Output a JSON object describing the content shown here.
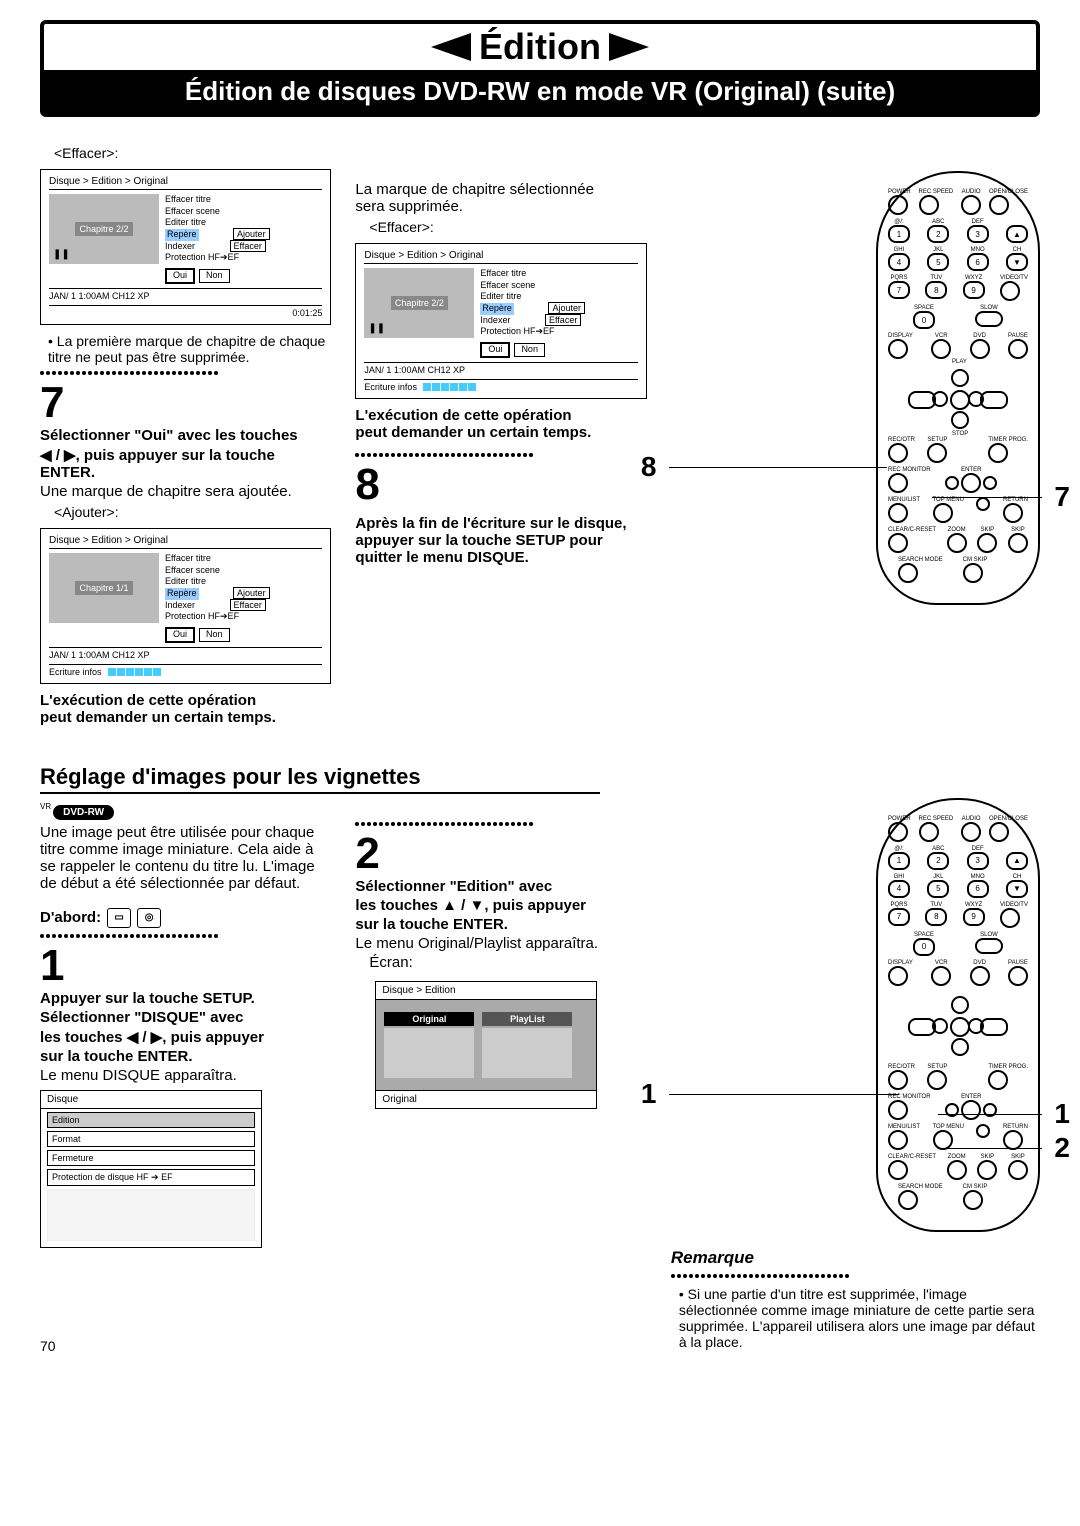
{
  "header": {
    "title": "Édition",
    "subtitle": "Édition de disques DVD-RW en mode VR (Original) (suite)"
  },
  "s1": {
    "lbl_effacer": "<Effacer>:",
    "screen1": {
      "crumb": "Disque > Edition > Original",
      "chap": "Chapitre 2/2",
      "pause": "❚❚",
      "m1": "Effacer titre",
      "m2": "Effacer scene",
      "m3": "Editer titre",
      "m4": "Repère",
      "m5": "Indexer",
      "m6": "Protection HF➔EF",
      "sub1": "Ajouter",
      "sub2": "Effacer",
      "oui": "Oui",
      "non": "Non",
      "foot_l": "JAN/ 1   1:00AM   CH12     XP",
      "foot_r": "0:01:25"
    },
    "bullet1": "La première marque de chapitre de chaque titre ne peut pas être supprimée.",
    "num7": "7",
    "step7a": "Sélectionner \"Oui\" avec les touches",
    "step7b": "◀ / ▶, puis appuyer sur la touche ENTER.",
    "step7c": "Une marque de chapitre sera ajoutée.",
    "lbl_ajouter": "<Ajouter>:",
    "screen2": {
      "crumb": "Disque > Edition > Original",
      "chap": "Chapitre 1/1",
      "m1": "Effacer titre",
      "m2": "Effacer scene",
      "m3": "Editer titre",
      "m4": "Repère",
      "m5": "Indexer",
      "m6": "Protection HF➔EF",
      "sub1": "Ajouter",
      "sub2": "Effacer",
      "oui": "Oui",
      "non": "Non",
      "foot_l": "JAN/ 1   1:00AM   CH12     XP",
      "write": "Ecriture infos"
    },
    "note1a": "L'exécution de cette opération",
    "note1b": "peut demander un certain temps."
  },
  "s2": {
    "p1a": "La marque de chapitre sélectionnée",
    "p1b": "sera supprimée.",
    "lbl_effacer": "<Effacer>:",
    "screen3": {
      "crumb": "Disque > Edition > Original",
      "chap": "Chapitre 2/2",
      "pause": "❚❚",
      "m1": "Effacer titre",
      "m2": "Effacer scene",
      "m3": "Editer titre",
      "m4": "Repère",
      "m5": "Indexer",
      "m6": "Protection HF➔EF",
      "sub1": "Ajouter",
      "sub2": "Effacer",
      "oui": "Oui",
      "non": "Non",
      "foot_l": "JAN/ 1   1:00AM   CH12     XP",
      "write": "Ecriture infos"
    },
    "note2a": "L'exécution de cette opération",
    "note2b": "peut demander un certain temps.",
    "num8": "8",
    "step8": "Après la fin de l'écriture sur le disque, appuyer sur la touche SETUP pour quitter le menu DISQUE."
  },
  "remote1": {
    "c8": "8",
    "c7": "7"
  },
  "section2": {
    "title": "Réglage d'images pour les vignettes",
    "badge": "DVD-RW",
    "vr": "VR",
    "p1": "Une image peut être utilisée pour chaque titre comme image miniature. Cela aide à se rappeler le contenu du titre lu. L'image de début a été sélectionnée par défaut.",
    "dabord": "D'abord:",
    "num1": "1",
    "s1a": "Appuyer sur la touche SETUP.",
    "s1b": "Sélectionner \"DISQUE\" avec",
    "s1c": "les touches ◀ / ▶, puis appuyer",
    "s1d": "sur la touche ENTER.",
    "s1e": "Le menu DISQUE apparaîtra.",
    "disque": {
      "hd": "Disque",
      "i1": "Edition",
      "i2": "Format",
      "i3": "Fermeture",
      "i4": "Protection de disque HF ➔ EF"
    },
    "num2": "2",
    "s2a": "Sélectionner \"Edition\" avec",
    "s2b": "les touches ▲ / ▼, puis appuyer",
    "s2c": "sur la touche ENTER.",
    "s2d": "Le menu Original/Playlist apparaîtra.",
    "s2e": "Écran:",
    "ed": {
      "crumb": "Disque > Edition",
      "c1": "Original",
      "c2": "PlayList",
      "ft": "Original"
    },
    "rem": "Remarque",
    "remtext": "Si une partie d'un titre est supprimée, l'image sélectionnée comme image miniature de cette partie sera supprimée. L'appareil utilisera alors une image par défaut à la place.",
    "rc1": "1",
    "rc12a": "1",
    "rc12b": "2"
  },
  "page": "70",
  "rbtns": {
    "power": "POWER",
    "recspd": "REC SPEED",
    "audio": "AUDIO",
    "oc": "OPEN/CLOSE",
    "abc": "ABC",
    "def": "DEF",
    "ghi": "GHI",
    "jkl": "JKL",
    "mno": "MNO",
    "ch": "CH",
    "pqrs": "PQRS",
    "tuv": "TUV",
    "wxyz": "WXYZ",
    "vt": "VIDEO/TV",
    "space": "SPACE",
    "slow": "SLOW",
    "display": "DISPLAY",
    "vcr": "VCR",
    "dvd": "DVD",
    "pause": "PAUSE",
    "play": "PLAY",
    "stop": "STOP",
    "recotr": "REC/OTR",
    "setup": "SETUP",
    "timerp": "TIMER PROG.",
    "recmon": "REC MONITOR",
    "enter": "ENTER",
    "menulist": "MENU/LIST",
    "topmenu": "TOP MENU",
    "return": "RETURN",
    "clear": "CLEAR/C-RESET",
    "zoom": "ZOOM",
    "skip": "SKIP",
    "search": "SEARCH MODE",
    "cmskip": "CM SKIP"
  }
}
